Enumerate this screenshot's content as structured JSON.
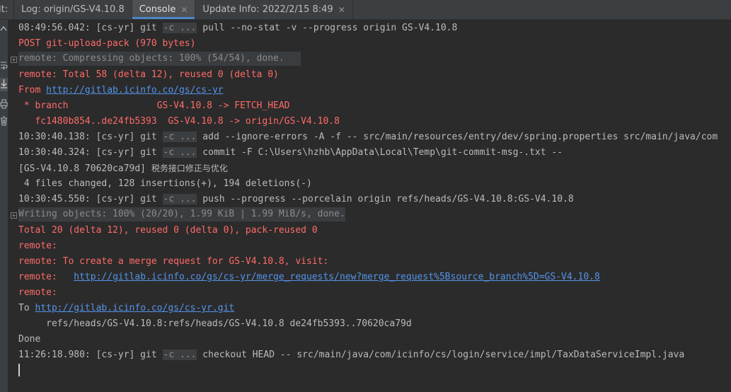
{
  "tabs": {
    "prefix": "it:",
    "items": [
      {
        "label": "Log: origin/GS-V4.10.8",
        "active": false,
        "closable": false
      },
      {
        "label": "Console",
        "active": true,
        "closable": true
      },
      {
        "label": "Update Info: 2022/2/15 8:49",
        "active": false,
        "closable": true
      }
    ],
    "close_glyph": "✕"
  },
  "toolbar": {
    "icons": [
      "scroll-up-icon",
      "soft-wrap-icon",
      "scroll-to-end-icon",
      "print-icon",
      "trash-icon"
    ]
  },
  "console": {
    "chip_text": "-c ...",
    "lines": {
      "l1_ts": "08:49:56.042: [cs-yr] git ",
      "l1_cmd": " pull --no-stat -v --progress origin GS-V4.10.8",
      "l2": "POST git-upload-pack (970 bytes)",
      "l3": "remote: Compressing objects: 100% (54/54), done.",
      "l4": "remote: Total 58 (delta 12), reused 0 (delta 0)",
      "l5_prefix": "From ",
      "l5_link": "http://gitlab.icinfo.co/gs/cs-yr",
      "l6": " * branch                GS-V4.10.8 -> FETCH_HEAD",
      "l7": "   fc1480b854..de24fb5393  GS-V4.10.8 -> origin/GS-V4.10.8",
      "l8_ts": "10:30:40.138: [cs-yr] git ",
      "l8_cmd": " add --ignore-errors -A -f -- src/main/resources/entry/dev/spring.properties src/main/java/com",
      "l9_ts": "10:30:40.324: [cs-yr] git ",
      "l9_cmd": " commit -F C:\\Users\\hzhb\\AppData\\Local\\Temp\\git-commit-msg-.txt --",
      "l10_a": "[GS-V4.10.8 70620ca79d] ",
      "l10_b": "税务接口修正与优化",
      "l11": " 4 files changed, 128 insertions(+), 194 deletions(-)",
      "l12_ts": "10:30:45.550: [cs-yr] git ",
      "l12_cmd": " push --progress --porcelain origin refs/heads/GS-V4.10.8:GS-V4.10.8",
      "l13": "Writing objects: 100% (20/20), 1.99 KiB | 1.99 MiB/s, done.",
      "l14": "Total 20 (delta 12), reused 0 (delta 0), pack-reused 0",
      "l15": "remote:",
      "l16": "remote: To create a merge request for GS-V4.10.8, visit:",
      "l17_prefix": "remote:   ",
      "l17_link": "http://gitlab.icinfo.co/gs/cs-yr/merge_requests/new?merge_request%5Bsource_branch%5D=GS-V4.10.8",
      "l18": "remote:",
      "l19_prefix": "To ",
      "l19_link": "http://gitlab.icinfo.co/gs/cs-yr.git",
      "l20": "     refs/heads/GS-V4.10.8:refs/heads/GS-V4.10.8 de24fb5393..70620ca79d",
      "l21": "Done",
      "l22_ts": "11:26:18.980: [cs-yr] git ",
      "l22_cmd": " checkout HEAD -- src/main/java/com/icinfo/cs/login/service/impl/TaxDataServiceImpl.java"
    }
  },
  "colors": {
    "error_red": "#ff6b68",
    "link_blue": "#5394ec",
    "text_gray": "#bbbbbb",
    "tab_accent": "#4a88c7"
  }
}
